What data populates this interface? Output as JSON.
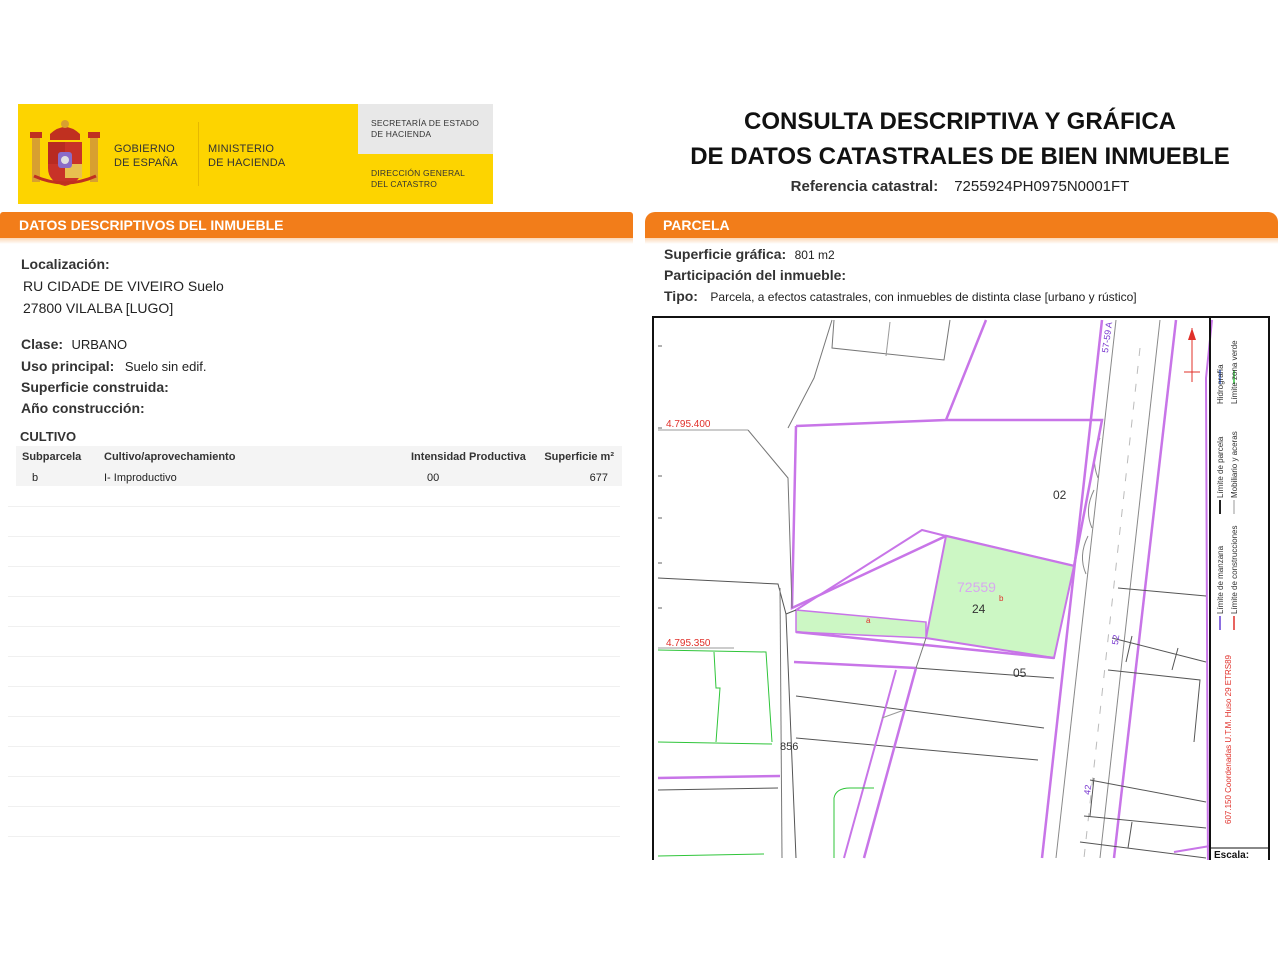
{
  "header": {
    "gov_line1": "GOBIERNO",
    "gov_line2": "DE ESPAÑA",
    "min_line1": "MINISTERIO",
    "min_line2": "DE HACIENDA",
    "sec_line1": "SECRETARÍA DE ESTADO",
    "sec_line2": "DE HACIENDA",
    "dir_line1": "DIRECCIÓN GENERAL",
    "dir_line2": "DEL CATASTRO",
    "title_line1": "CONSULTA DESCRIPTIVA Y GRÁFICA",
    "title_line2": "DE DATOS CATASTRALES DE BIEN INMUEBLE",
    "ref_label": "Referencia catastral:",
    "ref_value": "7255924PH0975N0001FT"
  },
  "left": {
    "bar_title": "DATOS DESCRIPTIVOS DEL INMUEBLE",
    "loc_label": "Localización:",
    "loc_line1": "RU CIDADE DE VIVEIRO  Suelo",
    "loc_line2": "27800 VILALBA [LUGO]",
    "clase_label": "Clase:",
    "clase_value": "URBANO",
    "uso_label": "Uso principal:",
    "uso_value": "Suelo sin edif.",
    "sup_label": "Superficie construida:",
    "anio_label": "Año construcción:",
    "cultivo_title": "CULTIVO",
    "table_headers": [
      "Subparcela",
      "Cultivo/aprovechamiento",
      "Intensidad Productiva",
      "Superficie m²"
    ],
    "table_rows": [
      [
        "b",
        "I- Improductivo",
        "00",
        "677"
      ]
    ]
  },
  "right": {
    "bar_title": "PARCELA",
    "supgraf_label": "Superficie gráfica:",
    "supgraf_value": "801 m2",
    "part_label": "Participación del inmueble:",
    "tipo_label": "Tipo:",
    "tipo_value": "Parcela, a efectos catastrales, con inmuebles de distinta clase [urbano y rústico]"
  },
  "map": {
    "coord_y1": "4.795.400",
    "coord_y2": "4.795.350",
    "parcel_ref": "72559",
    "parcel_num": "24",
    "sub_a": "a",
    "sub_b": "b",
    "lbl_02": "02",
    "lbl_05": "05",
    "lbl_856": "856",
    "lbl_57": "57-59 A",
    "lbl_52": "52",
    "lbl_42": "42",
    "legend_1": "Límite de manzana",
    "legend_2": "Límite de parcela",
    "legend_3": "Hidrografía",
    "legend_4": "Límite de construcciones",
    "legend_5": "Mobiliario y aceras",
    "legend_6": "Límite zona verde",
    "coord_note": "607.150 Coordenadas U.T.M. Huso 29 ETRS89",
    "escala": "Escala:",
    "colors": {
      "purple": "#c875e8",
      "parcel_fill": "#ccf7c4",
      "red_coord": "#e0302a",
      "green_line": "#2fc53a"
    }
  }
}
